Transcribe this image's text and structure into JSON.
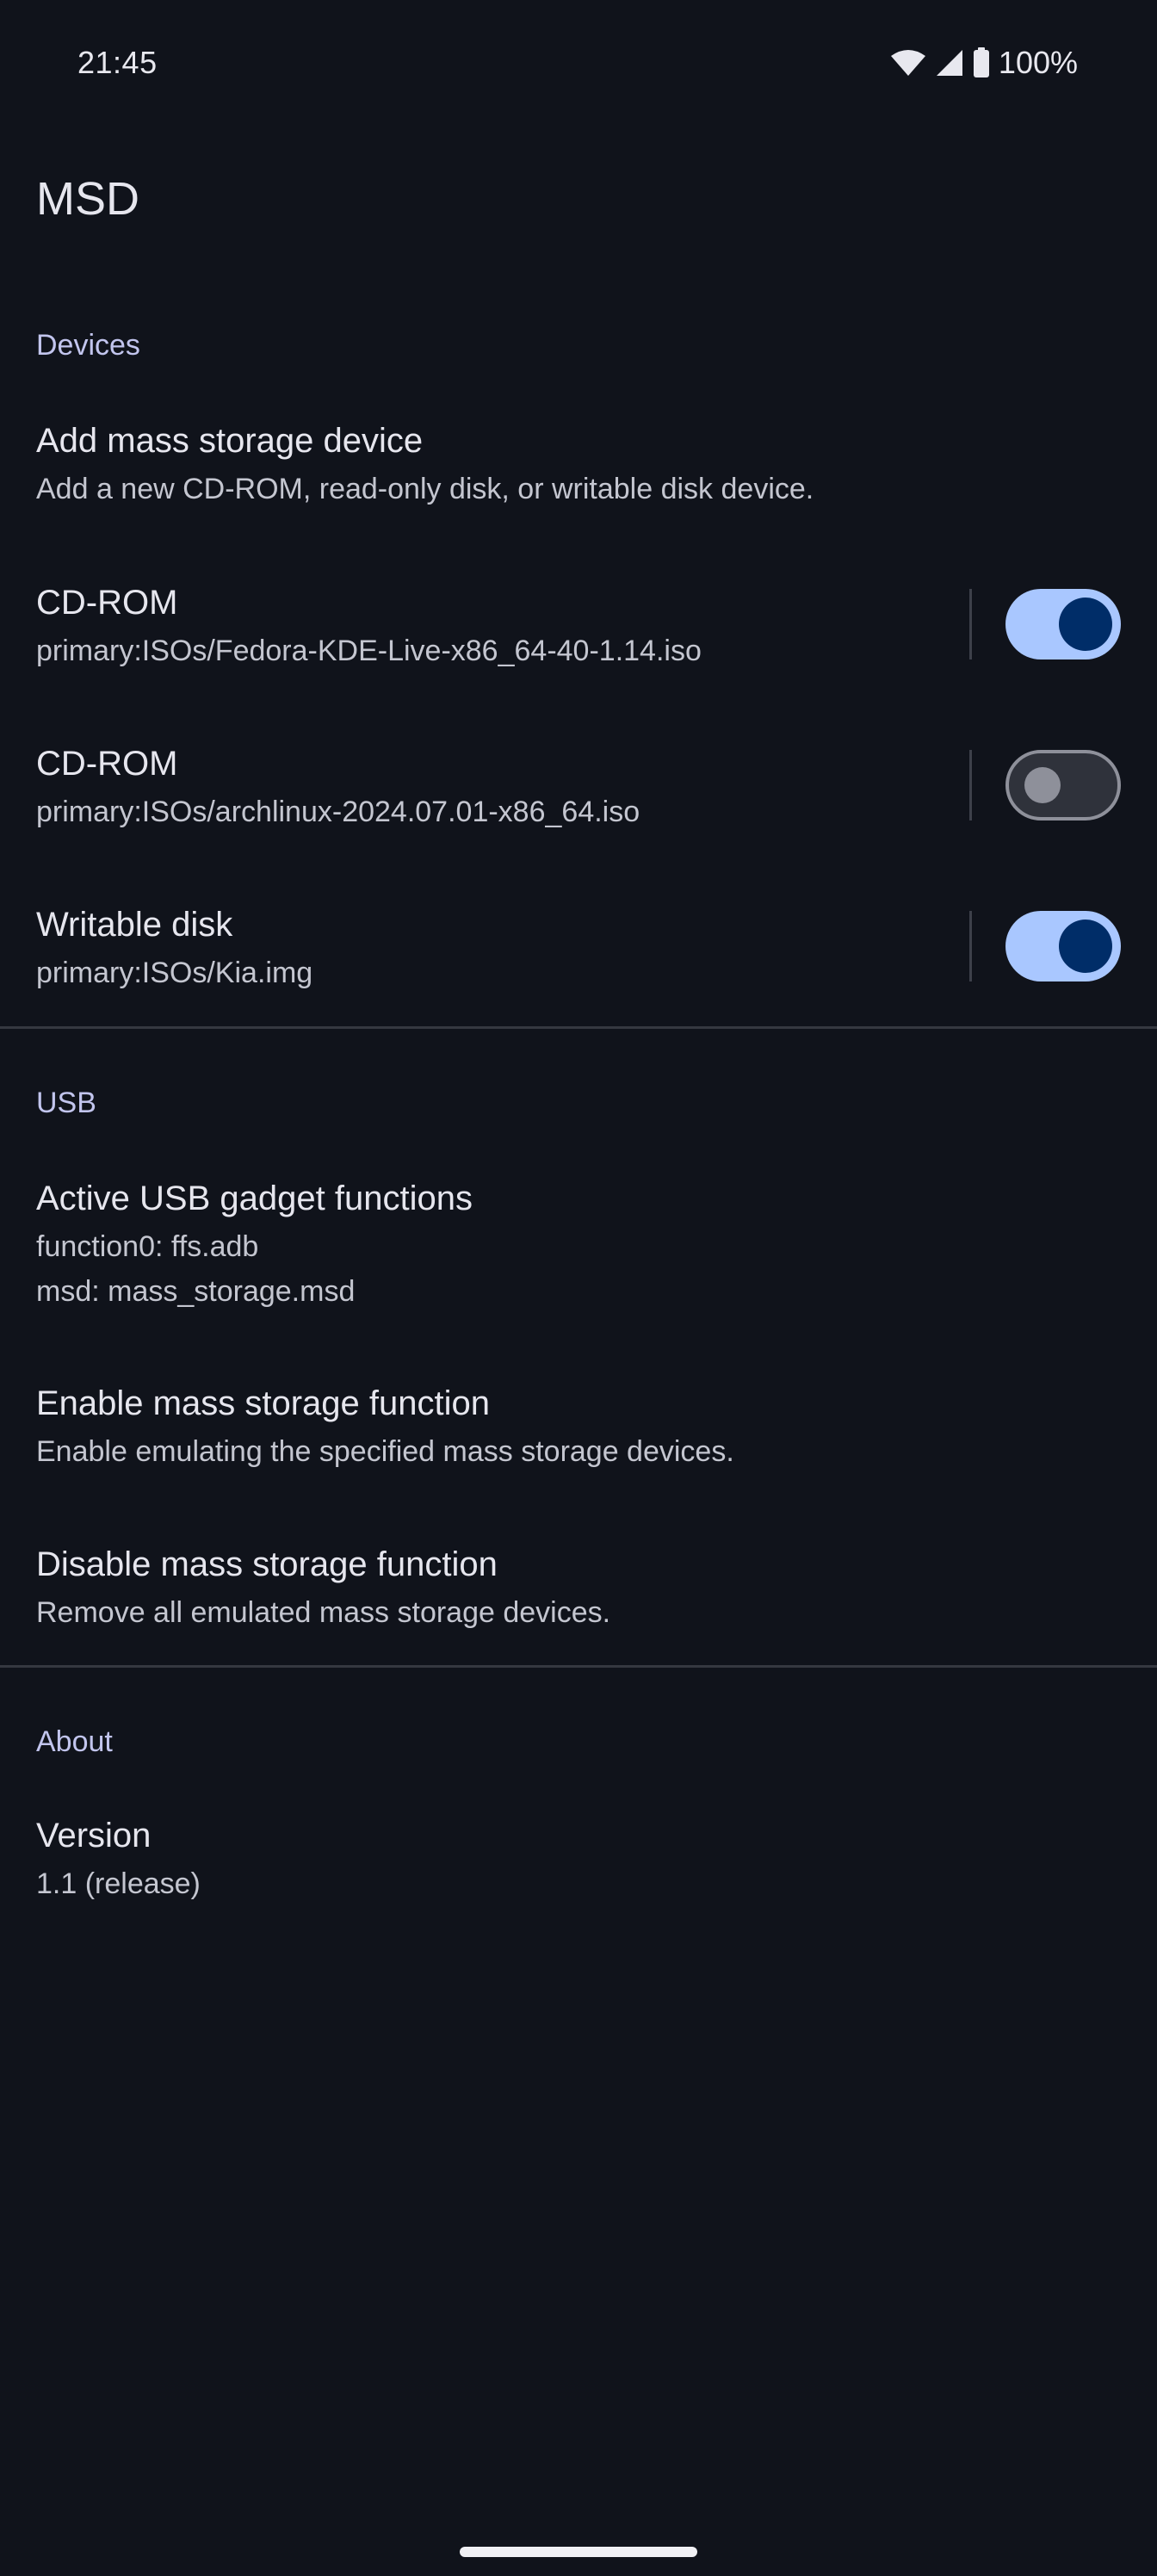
{
  "status_bar": {
    "time": "21:45",
    "battery_percent": "100%",
    "icons": [
      "wifi-icon",
      "signal-icon",
      "battery-icon"
    ]
  },
  "app": {
    "title": "MSD"
  },
  "sections": {
    "devices": {
      "header": "Devices",
      "add_device": {
        "title": "Add mass storage device",
        "summary": "Add a new CD-ROM, read-only disk, or writable disk device."
      },
      "items": [
        {
          "title": "CD-ROM",
          "summary": "primary:ISOs/Fedora-KDE-Live-x86_64-40-1.14.iso",
          "enabled": true
        },
        {
          "title": "CD-ROM",
          "summary": "primary:ISOs/archlinux-2024.07.01-x86_64.iso",
          "enabled": false
        },
        {
          "title": "Writable disk",
          "summary": "primary:ISOs/Kia.img",
          "enabled": true
        }
      ]
    },
    "usb": {
      "header": "USB",
      "active_functions": {
        "title": "Active USB gadget functions",
        "lines": [
          "function0: ffs.adb",
          "msd: mass_storage.msd"
        ]
      },
      "enable": {
        "title": "Enable mass storage function",
        "summary": "Enable emulating the specified mass storage devices."
      },
      "disable": {
        "title": "Disable mass storage function",
        "summary": "Remove all emulated mass storage devices."
      }
    },
    "about": {
      "header": "About",
      "version": {
        "title": "Version",
        "summary": "1.1 (release)"
      }
    }
  },
  "colors": {
    "background": "#10131b",
    "accent": "#a9c7ff",
    "section_header": "#c2c5ee",
    "switch_thumb_on": "#002d68"
  }
}
